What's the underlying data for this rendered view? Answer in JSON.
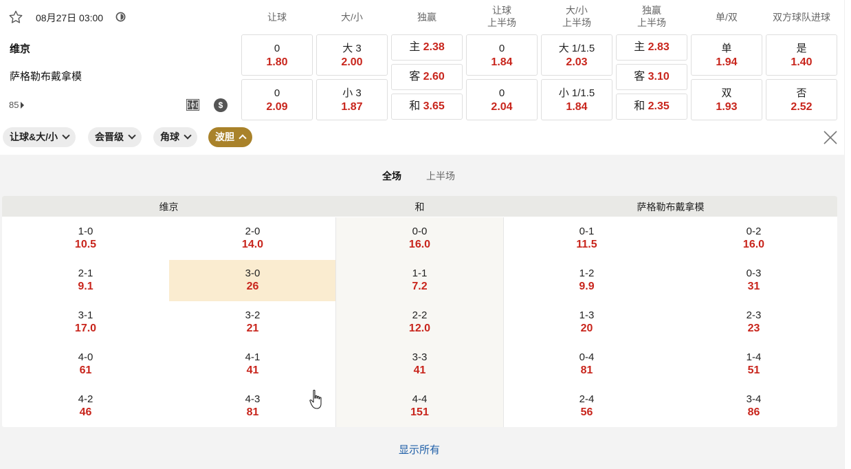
{
  "match": {
    "date": "08月27日 03:00",
    "home": "维京",
    "away": "萨格勒布戴拿模",
    "more_count": "85"
  },
  "columns": [
    {
      "l1": "让球",
      "l2": ""
    },
    {
      "l1": "大/小",
      "l2": ""
    },
    {
      "l1": "独赢",
      "l2": ""
    },
    {
      "l1": "让球",
      "l2": "上半场"
    },
    {
      "l1": "大/小",
      "l2": "上半场"
    },
    {
      "l1": "独赢",
      "l2": "上半场"
    },
    {
      "l1": "单/双",
      "l2": ""
    },
    {
      "l1": "双方球队进球",
      "l2": ""
    }
  ],
  "odds": {
    "handicap": [
      {
        "line": "0",
        "odd": "1.80"
      },
      {
        "line": "0",
        "odd": "2.09"
      }
    ],
    "ou": [
      {
        "line": "大 3",
        "odd": "2.00"
      },
      {
        "line": "小 3",
        "odd": "1.87"
      }
    ],
    "moneyline": [
      {
        "label": "主",
        "odd": "2.38"
      },
      {
        "label": "客",
        "odd": "2.60"
      },
      {
        "label": "和",
        "odd": "3.65"
      }
    ],
    "handicap_1h": [
      {
        "line": "0",
        "odd": "1.84"
      },
      {
        "line": "0",
        "odd": "2.04"
      }
    ],
    "ou_1h": [
      {
        "line": "大 1/1.5",
        "odd": "2.03"
      },
      {
        "line": "小 1/1.5",
        "odd": "1.84"
      }
    ],
    "moneyline_1h": [
      {
        "label": "主",
        "odd": "2.83"
      },
      {
        "label": "客",
        "odd": "3.10"
      },
      {
        "label": "和",
        "odd": "2.35"
      }
    ],
    "oddeven": [
      {
        "line": "单",
        "odd": "1.94"
      },
      {
        "line": "双",
        "odd": "1.93"
      }
    ],
    "btts": [
      {
        "line": "是",
        "odd": "1.40"
      },
      {
        "line": "否",
        "odd": "2.52"
      }
    ]
  },
  "filters": [
    "让球&大/小",
    "会晋级",
    "角球",
    "波胆"
  ],
  "tabs": [
    "全场",
    "上半场"
  ],
  "grid_headers": {
    "home": "维京",
    "draw": "和",
    "away": "萨格勒布戴拿模"
  },
  "scores": {
    "home_a": [
      [
        "1-0",
        "10.5"
      ],
      [
        "2-1",
        "9.1"
      ],
      [
        "3-1",
        "17.0"
      ],
      [
        "4-0",
        "61"
      ],
      [
        "4-2",
        "46"
      ]
    ],
    "home_b": [
      [
        "2-0",
        "14.0"
      ],
      [
        "3-0",
        "26"
      ],
      [
        "3-2",
        "21"
      ],
      [
        "4-1",
        "41"
      ],
      [
        "4-3",
        "81"
      ]
    ],
    "draw": [
      [
        "0-0",
        "16.0"
      ],
      [
        "1-1",
        "7.2"
      ],
      [
        "2-2",
        "12.0"
      ],
      [
        "3-3",
        "41"
      ],
      [
        "4-4",
        "151"
      ]
    ],
    "away_a": [
      [
        "0-1",
        "11.5"
      ],
      [
        "1-2",
        "9.9"
      ],
      [
        "1-3",
        "20"
      ],
      [
        "0-4",
        "81"
      ],
      [
        "2-4",
        "56"
      ]
    ],
    "away_b": [
      [
        "0-2",
        "16.0"
      ],
      [
        "0-3",
        "31"
      ],
      [
        "2-3",
        "23"
      ],
      [
        "1-4",
        "51"
      ],
      [
        "3-4",
        "86"
      ]
    ]
  },
  "show_all": "显示所有",
  "colors": {
    "odd": "#c8251c",
    "active_chip": "#a9822a",
    "highlight": "#faecd0",
    "link": "#1f5fa8"
  }
}
